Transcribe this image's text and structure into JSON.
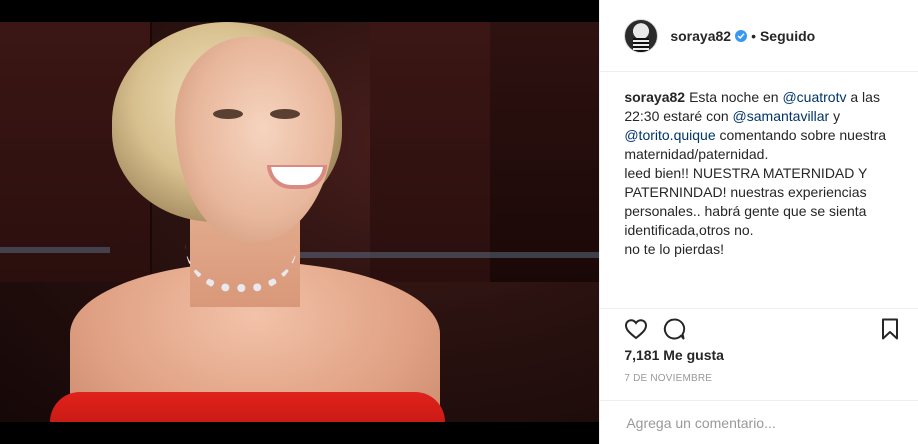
{
  "post": {
    "username": "soraya82",
    "verified_icon": "verified-badge-icon",
    "separator": "•",
    "follow_state": "Seguido",
    "caption": {
      "username": "soraya82",
      "lines": [
        [
          "Esta noche en ",
          "@cuatrotv",
          " a las"
        ],
        [
          "22:30 estaré con ",
          "@samantavillar",
          " y"
        ],
        [
          "",
          "@torito.quique",
          " comentando sobre nuestra"
        ],
        [
          "maternidad/paternidad."
        ],
        [
          "leed bien!! NUESTRA MATERNIDAD Y"
        ],
        [
          "PATERNINDAD! nuestras experiencias"
        ],
        [
          "personales.. habrá gente que se sienta"
        ],
        [
          "identificada,otros no."
        ],
        [
          "no te lo pierdas!"
        ]
      ],
      "mention_1": "@cuatrotv",
      "mention_2": "@samantavillar",
      "mention_3": "@torito.quique"
    },
    "actions": {
      "like_icon": "heart-icon",
      "comment_icon": "comment-bubble-icon",
      "save_icon": "bookmark-icon"
    },
    "likes": "7,181 Me gusta",
    "date": "7 DE NOVIEMBRE",
    "comment_placeholder": "Agrega un comentario..."
  },
  "colors": {
    "text": "#262626",
    "muted": "#999999",
    "link": "#003569",
    "verified": "#3897f0",
    "dress": "#e0221b"
  }
}
